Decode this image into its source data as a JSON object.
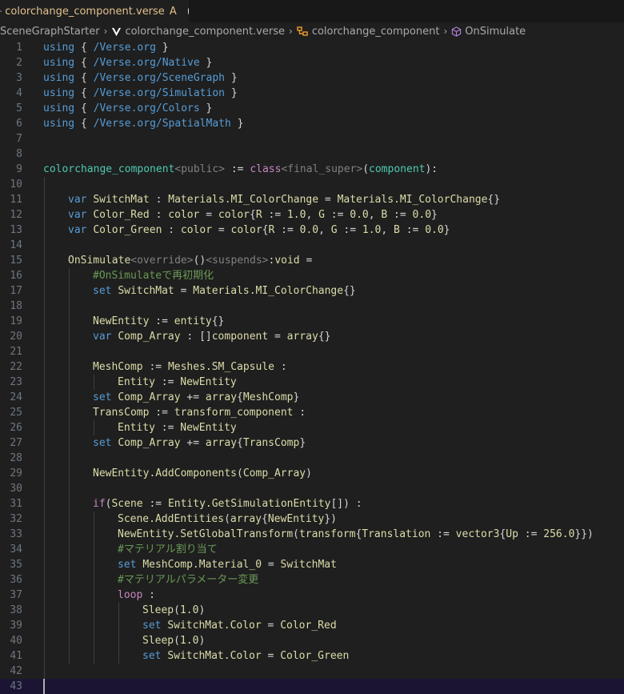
{
  "tab": {
    "filename": "colorchange_component.verse",
    "status": "A"
  },
  "breadcrumb": [
    "SceneGraphStarter",
    "colorchange_component.verse",
    "colorchange_component",
    "OnSimulate"
  ],
  "editor": {
    "lines": [
      {
        "n": "1",
        "indent": 0,
        "tokens": [
          {
            "c": "kw",
            "t": "using"
          },
          {
            "c": "punc",
            "t": " { "
          },
          {
            "c": "path",
            "t": "/Verse.org"
          },
          {
            "c": "punc",
            "t": " }"
          }
        ]
      },
      {
        "n": "2",
        "indent": 0,
        "tokens": [
          {
            "c": "kw",
            "t": "using"
          },
          {
            "c": "punc",
            "t": " { "
          },
          {
            "c": "path",
            "t": "/Verse.org/Native"
          },
          {
            "c": "punc",
            "t": " }"
          }
        ]
      },
      {
        "n": "3",
        "indent": 0,
        "tokens": [
          {
            "c": "kw",
            "t": "using"
          },
          {
            "c": "punc",
            "t": " { "
          },
          {
            "c": "path",
            "t": "/Verse.org/SceneGraph"
          },
          {
            "c": "punc",
            "t": " }"
          }
        ]
      },
      {
        "n": "4",
        "indent": 0,
        "tokens": [
          {
            "c": "kw",
            "t": "using"
          },
          {
            "c": "punc",
            "t": " { "
          },
          {
            "c": "path",
            "t": "/Verse.org/Simulation"
          },
          {
            "c": "punc",
            "t": " }"
          }
        ]
      },
      {
        "n": "5",
        "indent": 0,
        "tokens": [
          {
            "c": "kw",
            "t": "using"
          },
          {
            "c": "punc",
            "t": " { "
          },
          {
            "c": "path",
            "t": "/Verse.org/Colors"
          },
          {
            "c": "punc",
            "t": " }"
          }
        ]
      },
      {
        "n": "6",
        "indent": 0,
        "tokens": [
          {
            "c": "kw",
            "t": "using"
          },
          {
            "c": "punc",
            "t": " { "
          },
          {
            "c": "path",
            "t": "/Verse.org/SpatialMath"
          },
          {
            "c": "punc",
            "t": " }"
          }
        ]
      },
      {
        "n": "7",
        "indent": 0,
        "tokens": []
      },
      {
        "n": "8",
        "indent": 0,
        "tokens": []
      },
      {
        "n": "9",
        "indent": 0,
        "tokens": [
          {
            "c": "type",
            "t": "colorchange_component"
          },
          {
            "c": "spec",
            "t": "<public>"
          },
          {
            "c": "punc",
            "t": " := "
          },
          {
            "c": "kw2",
            "t": "class"
          },
          {
            "c": "spec",
            "t": "<final_super>"
          },
          {
            "c": "punc",
            "t": "("
          },
          {
            "c": "type",
            "t": "component"
          },
          {
            "c": "punc",
            "t": "):"
          }
        ]
      },
      {
        "n": "10",
        "indent": 1,
        "tokens": []
      },
      {
        "n": "11",
        "indent": 1,
        "tokens": [
          {
            "c": "kw",
            "t": "var"
          },
          {
            "c": "punc",
            "t": " "
          },
          {
            "c": "plain",
            "t": "SwitchMat"
          },
          {
            "c": "punc",
            "t": " : "
          },
          {
            "c": "plain",
            "t": "Materials.MI_ColorChange"
          },
          {
            "c": "punc",
            "t": " = "
          },
          {
            "c": "plain",
            "t": "Materials.MI_ColorChange"
          },
          {
            "c": "punc",
            "t": "{}"
          }
        ]
      },
      {
        "n": "12",
        "indent": 1,
        "tokens": [
          {
            "c": "kw",
            "t": "var"
          },
          {
            "c": "punc",
            "t": " "
          },
          {
            "c": "plain",
            "t": "Color_Red"
          },
          {
            "c": "punc",
            "t": " : "
          },
          {
            "c": "plain",
            "t": "color"
          },
          {
            "c": "punc",
            "t": " = "
          },
          {
            "c": "plain",
            "t": "color"
          },
          {
            "c": "punc",
            "t": "{"
          },
          {
            "c": "plain",
            "t": "R"
          },
          {
            "c": "punc",
            "t": " := "
          },
          {
            "c": "plain",
            "t": "1.0"
          },
          {
            "c": "punc",
            "t": ", "
          },
          {
            "c": "plain",
            "t": "G"
          },
          {
            "c": "punc",
            "t": " := "
          },
          {
            "c": "plain",
            "t": "0.0"
          },
          {
            "c": "punc",
            "t": ", "
          },
          {
            "c": "plain",
            "t": "B"
          },
          {
            "c": "punc",
            "t": " := "
          },
          {
            "c": "plain",
            "t": "0.0"
          },
          {
            "c": "punc",
            "t": "}"
          }
        ]
      },
      {
        "n": "13",
        "indent": 1,
        "tokens": [
          {
            "c": "kw",
            "t": "var"
          },
          {
            "c": "punc",
            "t": " "
          },
          {
            "c": "plain",
            "t": "Color_Green"
          },
          {
            "c": "punc",
            "t": " : "
          },
          {
            "c": "plain",
            "t": "color"
          },
          {
            "c": "punc",
            "t": " = "
          },
          {
            "c": "plain",
            "t": "color"
          },
          {
            "c": "punc",
            "t": "{"
          },
          {
            "c": "plain",
            "t": "R"
          },
          {
            "c": "punc",
            "t": " := "
          },
          {
            "c": "plain",
            "t": "0.0"
          },
          {
            "c": "punc",
            "t": ", "
          },
          {
            "c": "plain",
            "t": "G"
          },
          {
            "c": "punc",
            "t": " := "
          },
          {
            "c": "plain",
            "t": "1.0"
          },
          {
            "c": "punc",
            "t": ", "
          },
          {
            "c": "plain",
            "t": "B"
          },
          {
            "c": "punc",
            "t": " := "
          },
          {
            "c": "plain",
            "t": "0.0"
          },
          {
            "c": "punc",
            "t": "}"
          }
        ]
      },
      {
        "n": "14",
        "indent": 1,
        "tokens": []
      },
      {
        "n": "15",
        "indent": 1,
        "tokens": [
          {
            "c": "plain",
            "t": "OnSimulate"
          },
          {
            "c": "spec",
            "t": "<override>"
          },
          {
            "c": "punc",
            "t": "()"
          },
          {
            "c": "spec",
            "t": "<suspends>"
          },
          {
            "c": "punc",
            "t": ":"
          },
          {
            "c": "plain",
            "t": "void"
          },
          {
            "c": "punc",
            "t": " ="
          }
        ]
      },
      {
        "n": "16",
        "indent": 2,
        "tokens": [
          {
            "c": "cmt",
            "t": "#OnSimulateで再初期化"
          }
        ]
      },
      {
        "n": "17",
        "indent": 2,
        "tokens": [
          {
            "c": "kw",
            "t": "set"
          },
          {
            "c": "punc",
            "t": " "
          },
          {
            "c": "plain",
            "t": "SwitchMat"
          },
          {
            "c": "punc",
            "t": " = "
          },
          {
            "c": "plain",
            "t": "Materials.MI_ColorChange"
          },
          {
            "c": "punc",
            "t": "{}"
          }
        ]
      },
      {
        "n": "18",
        "indent": 2,
        "tokens": []
      },
      {
        "n": "19",
        "indent": 2,
        "tokens": [
          {
            "c": "plain",
            "t": "NewEntity"
          },
          {
            "c": "punc",
            "t": " := "
          },
          {
            "c": "plain",
            "t": "entity"
          },
          {
            "c": "punc",
            "t": "{}"
          }
        ]
      },
      {
        "n": "20",
        "indent": 2,
        "tokens": [
          {
            "c": "kw",
            "t": "var"
          },
          {
            "c": "punc",
            "t": " "
          },
          {
            "c": "plain",
            "t": "Comp_Array"
          },
          {
            "c": "punc",
            "t": " : []"
          },
          {
            "c": "plain",
            "t": "component"
          },
          {
            "c": "punc",
            "t": " = "
          },
          {
            "c": "plain",
            "t": "array"
          },
          {
            "c": "punc",
            "t": "{}"
          }
        ]
      },
      {
        "n": "21",
        "indent": 2,
        "tokens": []
      },
      {
        "n": "22",
        "indent": 2,
        "tokens": [
          {
            "c": "plain",
            "t": "MeshComp"
          },
          {
            "c": "punc",
            "t": " := "
          },
          {
            "c": "plain",
            "t": "Meshes.SM_Capsule"
          },
          {
            "c": "punc",
            "t": " :"
          }
        ]
      },
      {
        "n": "23",
        "indent": 3,
        "tokens": [
          {
            "c": "plain",
            "t": "Entity"
          },
          {
            "c": "punc",
            "t": " := "
          },
          {
            "c": "plain",
            "t": "NewEntity"
          }
        ]
      },
      {
        "n": "24",
        "indent": 2,
        "tokens": [
          {
            "c": "kw",
            "t": "set"
          },
          {
            "c": "punc",
            "t": " "
          },
          {
            "c": "plain",
            "t": "Comp_Array"
          },
          {
            "c": "punc",
            "t": " += "
          },
          {
            "c": "plain",
            "t": "array"
          },
          {
            "c": "punc",
            "t": "{"
          },
          {
            "c": "plain",
            "t": "MeshComp"
          },
          {
            "c": "punc",
            "t": "}"
          }
        ]
      },
      {
        "n": "25",
        "indent": 2,
        "tokens": [
          {
            "c": "plain",
            "t": "TransComp"
          },
          {
            "c": "punc",
            "t": " := "
          },
          {
            "c": "plain",
            "t": "transform_component"
          },
          {
            "c": "punc",
            "t": " :"
          }
        ]
      },
      {
        "n": "26",
        "indent": 3,
        "tokens": [
          {
            "c": "plain",
            "t": "Entity"
          },
          {
            "c": "punc",
            "t": " := "
          },
          {
            "c": "plain",
            "t": "NewEntity"
          }
        ]
      },
      {
        "n": "27",
        "indent": 2,
        "tokens": [
          {
            "c": "kw",
            "t": "set"
          },
          {
            "c": "punc",
            "t": " "
          },
          {
            "c": "plain",
            "t": "Comp_Array"
          },
          {
            "c": "punc",
            "t": " += "
          },
          {
            "c": "plain",
            "t": "array"
          },
          {
            "c": "punc",
            "t": "{"
          },
          {
            "c": "plain",
            "t": "TransComp"
          },
          {
            "c": "punc",
            "t": "}"
          }
        ]
      },
      {
        "n": "28",
        "indent": 2,
        "tokens": []
      },
      {
        "n": "29",
        "indent": 2,
        "tokens": [
          {
            "c": "plain",
            "t": "NewEntity.AddComponents"
          },
          {
            "c": "punc",
            "t": "("
          },
          {
            "c": "plain",
            "t": "Comp_Array"
          },
          {
            "c": "punc",
            "t": ")"
          }
        ]
      },
      {
        "n": "30",
        "indent": 2,
        "tokens": []
      },
      {
        "n": "31",
        "indent": 2,
        "tokens": [
          {
            "c": "kw2",
            "t": "if"
          },
          {
            "c": "punc",
            "t": "("
          },
          {
            "c": "plain",
            "t": "Scene"
          },
          {
            "c": "punc",
            "t": " := "
          },
          {
            "c": "plain",
            "t": "Entity.GetSimulationEntity"
          },
          {
            "c": "punc",
            "t": "[]) :"
          }
        ]
      },
      {
        "n": "32",
        "indent": 3,
        "tokens": [
          {
            "c": "plain",
            "t": "Scene.AddEntities"
          },
          {
            "c": "punc",
            "t": "("
          },
          {
            "c": "plain",
            "t": "array"
          },
          {
            "c": "punc",
            "t": "{"
          },
          {
            "c": "plain",
            "t": "NewEntity"
          },
          {
            "c": "punc",
            "t": "})"
          }
        ]
      },
      {
        "n": "33",
        "indent": 3,
        "tokens": [
          {
            "c": "plain",
            "t": "NewEntity.SetGlobalTransform"
          },
          {
            "c": "punc",
            "t": "("
          },
          {
            "c": "plain",
            "t": "transform"
          },
          {
            "c": "punc",
            "t": "{"
          },
          {
            "c": "plain",
            "t": "Translation"
          },
          {
            "c": "punc",
            "t": " := "
          },
          {
            "c": "plain",
            "t": "vector3"
          },
          {
            "c": "punc",
            "t": "{"
          },
          {
            "c": "plain",
            "t": "Up"
          },
          {
            "c": "punc",
            "t": " := "
          },
          {
            "c": "plain",
            "t": "256.0"
          },
          {
            "c": "punc",
            "t": "}})"
          }
        ]
      },
      {
        "n": "34",
        "indent": 3,
        "tokens": [
          {
            "c": "cmt",
            "t": "#マテリアル割り当て"
          }
        ]
      },
      {
        "n": "35",
        "indent": 3,
        "tokens": [
          {
            "c": "kw",
            "t": "set"
          },
          {
            "c": "punc",
            "t": " "
          },
          {
            "c": "plain",
            "t": "MeshComp.Material_0"
          },
          {
            "c": "punc",
            "t": " = "
          },
          {
            "c": "plain",
            "t": "SwitchMat"
          }
        ]
      },
      {
        "n": "36",
        "indent": 3,
        "tokens": [
          {
            "c": "cmt",
            "t": "#マテリアルパラメーター変更"
          }
        ]
      },
      {
        "n": "37",
        "indent": 3,
        "tokens": [
          {
            "c": "kw2",
            "t": "loop"
          },
          {
            "c": "punc",
            "t": " :"
          }
        ]
      },
      {
        "n": "38",
        "indent": 4,
        "tokens": [
          {
            "c": "plain",
            "t": "Sleep"
          },
          {
            "c": "punc",
            "t": "("
          },
          {
            "c": "plain",
            "t": "1.0"
          },
          {
            "c": "punc",
            "t": ")"
          }
        ]
      },
      {
        "n": "39",
        "indent": 4,
        "tokens": [
          {
            "c": "kw",
            "t": "set"
          },
          {
            "c": "punc",
            "t": " "
          },
          {
            "c": "plain",
            "t": "SwitchMat.Color"
          },
          {
            "c": "punc",
            "t": " = "
          },
          {
            "c": "plain",
            "t": "Color_Red"
          }
        ]
      },
      {
        "n": "40",
        "indent": 4,
        "tokens": [
          {
            "c": "plain",
            "t": "Sleep"
          },
          {
            "c": "punc",
            "t": "("
          },
          {
            "c": "plain",
            "t": "1.0"
          },
          {
            "c": "punc",
            "t": ")"
          }
        ]
      },
      {
        "n": "41",
        "indent": 4,
        "tokens": [
          {
            "c": "kw",
            "t": "set"
          },
          {
            "c": "punc",
            "t": " "
          },
          {
            "c": "plain",
            "t": "SwitchMat.Color"
          },
          {
            "c": "punc",
            "t": " = "
          },
          {
            "c": "plain",
            "t": "Color_Green"
          }
        ]
      },
      {
        "n": "42",
        "indent": 1,
        "tokens": []
      },
      {
        "n": "43",
        "indent": 0,
        "tokens": []
      }
    ]
  }
}
